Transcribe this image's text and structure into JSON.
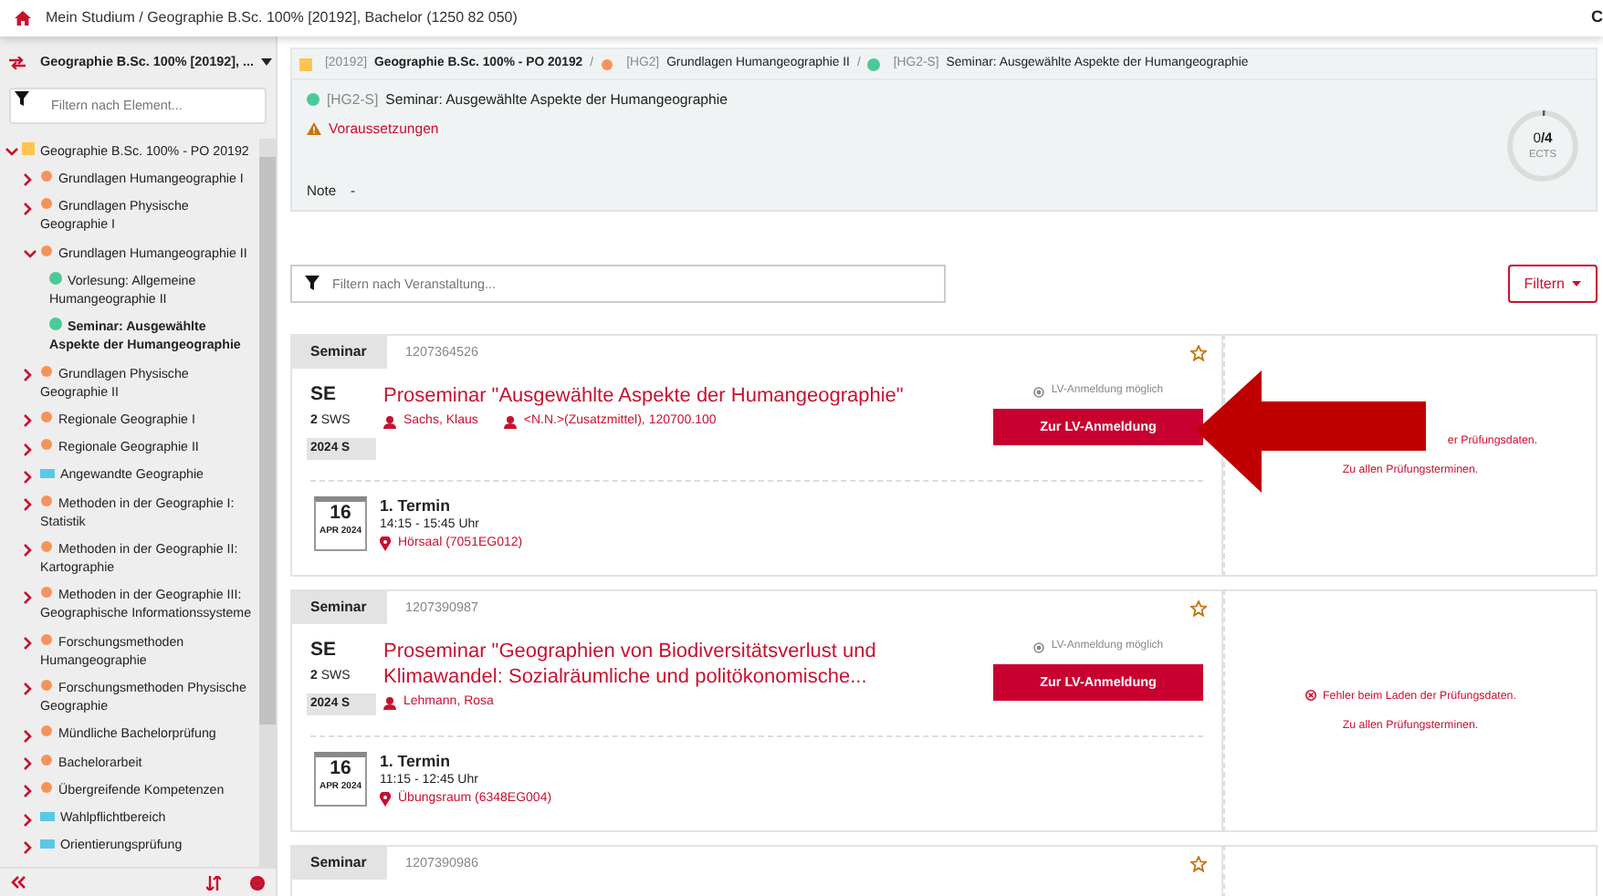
{
  "topbar": {
    "breadcrumb": "Mein Studium / Geographie B.Sc. 100% [20192], Bachelor (1250 82 050)",
    "corner": "C"
  },
  "sidebar": {
    "program": "Geographie B.Sc. 100% [20192], ...",
    "filter_placeholder": "Filtern nach Element...",
    "tree": [
      {
        "label": "Geographie B.Sc. 100% - PO 20192",
        "kind": "program",
        "color": "#fcc54e",
        "expanded": true,
        "children": [
          {
            "label": "Grundlagen Humangeographie I",
            "kind": "module",
            "color": "#f6935a",
            "expanded": false
          },
          {
            "label": "Grundlagen Physische Geographie I",
            "kind": "module",
            "color": "#f6935a",
            "expanded": false
          },
          {
            "label": "Grundlagen Humangeographie II",
            "kind": "module",
            "color": "#f6935a",
            "expanded": true,
            "children": [
              {
                "label": "Vorlesung: Allgemeine Humangeographie II",
                "kind": "course",
                "color": "#4cc99a",
                "selected": false
              },
              {
                "label": "Seminar: Ausgewählte Aspekte der Humangeographie",
                "kind": "course",
                "color": "#4cc99a",
                "selected": true
              }
            ]
          },
          {
            "label": "Grundlagen Physische Geographie II",
            "kind": "module",
            "color": "#f6935a",
            "expanded": false
          },
          {
            "label": "Regionale Geographie I",
            "kind": "module",
            "color": "#f6935a",
            "expanded": false
          },
          {
            "label": "Regionale Geographie II",
            "kind": "module",
            "color": "#f6935a",
            "expanded": false
          },
          {
            "label": "Angewandte Geographie",
            "kind": "area",
            "color": "#5bc8e8",
            "expanded": false
          },
          {
            "label": "Methoden in der Geographie I: Statistik",
            "kind": "module",
            "color": "#f6935a",
            "expanded": false
          },
          {
            "label": "Methoden in der Geographie II: Kartographie",
            "kind": "module",
            "color": "#f6935a",
            "expanded": false
          },
          {
            "label": "Methoden in der Geographie III: Geographische Informationssysteme",
            "kind": "module",
            "color": "#f6935a",
            "expanded": false
          },
          {
            "label": "Forschungsmethoden Humangeographie",
            "kind": "module",
            "color": "#f6935a",
            "expanded": false
          },
          {
            "label": "Forschungsmethoden Physische Geographie",
            "kind": "module",
            "color": "#f6935a",
            "expanded": false
          },
          {
            "label": "Mündliche Bachelorprüfung",
            "kind": "module",
            "color": "#f6935a",
            "expanded": false
          },
          {
            "label": "Bachelorarbeit",
            "kind": "module",
            "color": "#f6935a",
            "expanded": false
          },
          {
            "label": "Übergreifende Kompetenzen",
            "kind": "module",
            "color": "#f6935a",
            "expanded": false
          },
          {
            "label": "Wahlpflichtbereich",
            "kind": "area",
            "color": "#5bc8e8",
            "expanded": false
          },
          {
            "label": "Orientierungsprüfung",
            "kind": "area",
            "color": "#5bc8e8",
            "expanded": false
          }
        ]
      }
    ]
  },
  "breadcrumb": [
    {
      "code": "[20192]",
      "label": "Geographie B.Sc. 100% - PO 20192",
      "kind": "program",
      "color": "#fcc54e"
    },
    {
      "separator": "/",
      "code": "[HG2]",
      "label": "Grundlagen Humangeographie II",
      "kind": "module",
      "color": "#f6935a"
    },
    {
      "separator": "/",
      "code": "[HG2-S]",
      "label": "Seminar: Ausgewählte Aspekte der Humangeographie",
      "kind": "course",
      "color": "#4cc99a"
    }
  ],
  "detail": {
    "code": "[HG2-S]",
    "title": "Seminar: Ausgewählte Aspekte der Humangeographie",
    "color": "#4cc99a",
    "prerequisites": "Voraussetzungen",
    "grade_label": "Note",
    "grade": "-",
    "ects": "0",
    "ects_total": "/4",
    "ects_unit": "ECTS",
    "level": 0
  },
  "course_filter": {
    "placeholder": "Filtern nach Veranstaltung...",
    "button": "Filtern"
  },
  "courses": [
    {
      "type": "Seminar",
      "number": "1207364526",
      "code": "SE",
      "sws": "2",
      "sws_unit": "SWS",
      "semester": "2024 S",
      "title": "Proseminar \"Ausgewählte Aspekte der Humangeographie\"",
      "lecturers": [
        "Sachs, Klaus",
        "<N.N.>(Zusatzmittel), 120700.100"
      ],
      "status": "LV-Anmeldung möglich",
      "button": "Zur LV-Anmeldung",
      "date": {
        "day": "16",
        "month": "APR 2024",
        "label": "1. Termin",
        "time": "14:15 - 15:45 Uhr",
        "room": "Hörsaal (7051EG012)"
      },
      "exam_error": "er Prüfungsdaten.",
      "exam_error_icon": false,
      "exam_link": "Zu allen Prüfungsterminen."
    },
    {
      "type": "Seminar",
      "number": "1207390987",
      "code": "SE",
      "sws": "2",
      "sws_unit": "SWS",
      "semester": "2024 S",
      "title": "Proseminar \"Geographien von Biodiversitätsverlust und Klimawandel: Sozialräumliche und politökonomische...",
      "lecturers": [
        "Lehmann, Rosa"
      ],
      "status": "LV-Anmeldung möglich",
      "button": "Zur LV-Anmeldung",
      "date": {
        "day": "16",
        "month": "APR 2024",
        "label": "1. Termin",
        "time": "11:15 - 12:45 Uhr",
        "room": "Übungsraum (6348EG004)"
      },
      "exam_error": "Fehler beim Laden der Prüfungsdaten.",
      "exam_error_icon": true,
      "exam_link": "Zu allen Prüfungsterminen."
    },
    {
      "type": "Seminar",
      "number": "1207390986"
    }
  ]
}
